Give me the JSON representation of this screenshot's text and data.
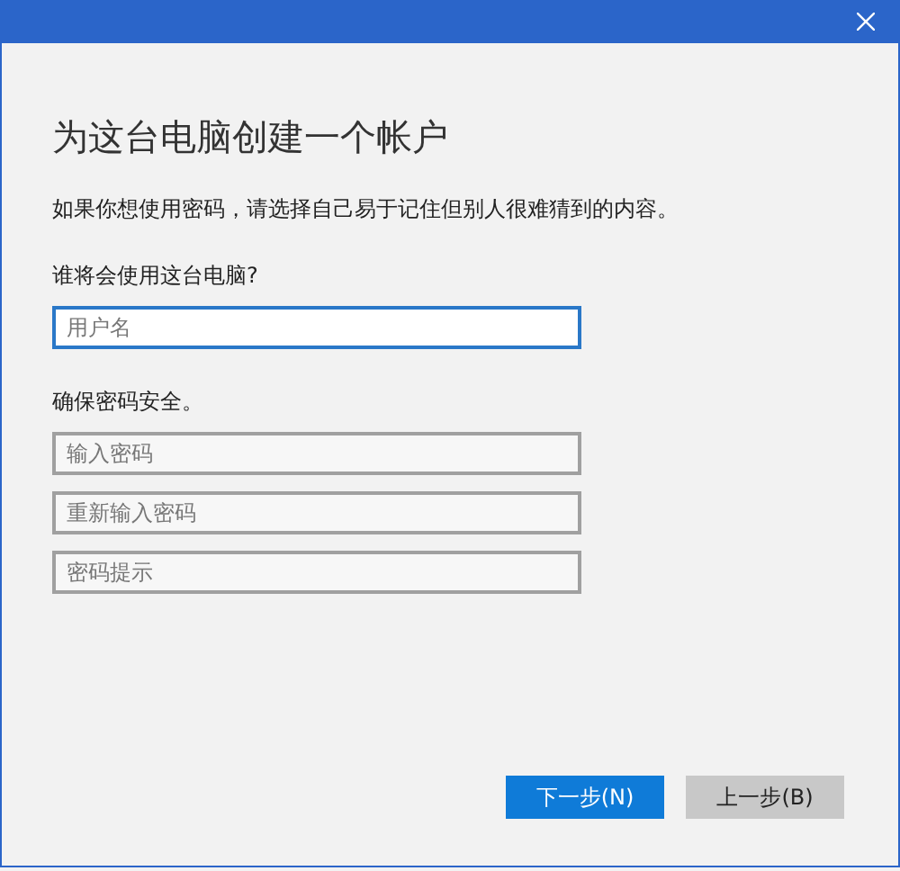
{
  "heading": "为这台电脑创建一个帐户",
  "description": "如果你想使用密码，请选择自己易于记住但别人很难猜到的内容。",
  "sections": [
    {
      "label": "谁将会使用这台电脑?",
      "fields": [
        {
          "placeholder": "用户名",
          "focused": true
        }
      ]
    },
    {
      "label": "确保密码安全。",
      "fields": [
        {
          "placeholder": "输入密码",
          "focused": false
        },
        {
          "placeholder": "重新输入密码",
          "focused": false
        },
        {
          "placeholder": "密码提示",
          "focused": false
        }
      ]
    }
  ],
  "buttons": [
    {
      "label": "下一步(N)",
      "kind": "primary"
    },
    {
      "label": "上一步(B)",
      "kind": "secondary"
    }
  ]
}
